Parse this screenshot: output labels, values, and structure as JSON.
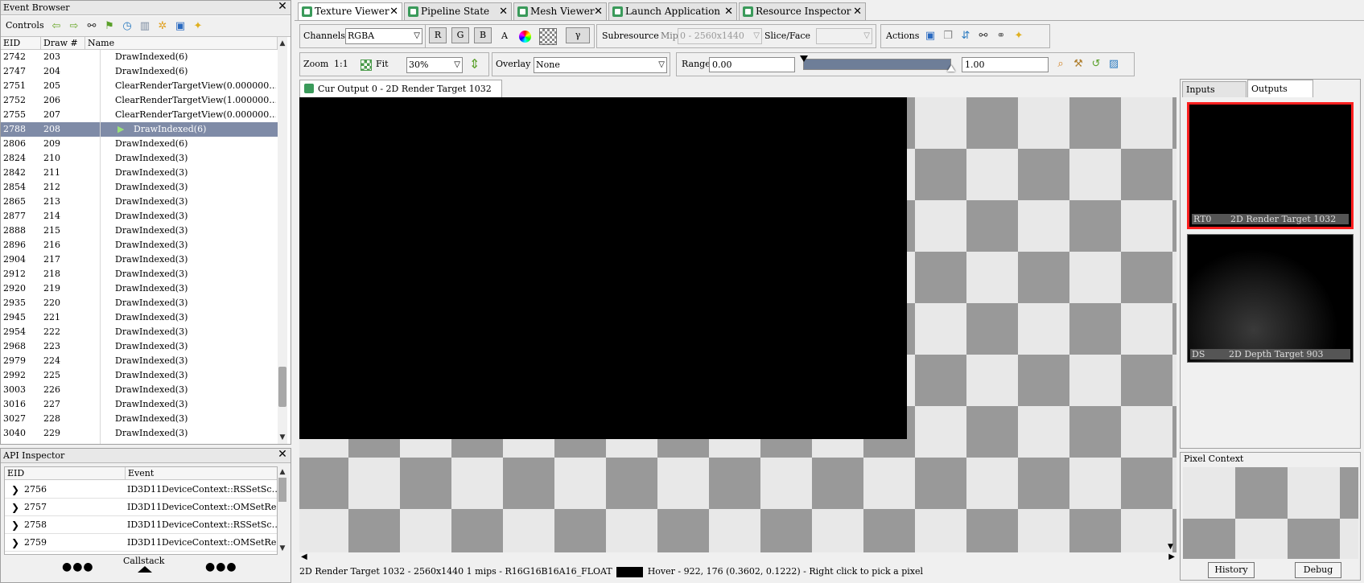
{
  "event_browser": {
    "title": "Event Browser",
    "controls_label": "Controls",
    "columns": [
      "EID",
      "Draw #",
      "Name"
    ],
    "selected_index": 5,
    "rows": [
      {
        "eid": "2742",
        "draw": "203",
        "name": "DrawIndexed(6)"
      },
      {
        "eid": "2747",
        "draw": "204",
        "name": "DrawIndexed(6)"
      },
      {
        "eid": "2751",
        "draw": "205",
        "name": "ClearRenderTargetView(0.000000…"
      },
      {
        "eid": "2752",
        "draw": "206",
        "name": "ClearRenderTargetView(1.000000…"
      },
      {
        "eid": "2755",
        "draw": "207",
        "name": "ClearRenderTargetView(0.000000…"
      },
      {
        "eid": "2788",
        "draw": "208",
        "name": "DrawIndexed(6)"
      },
      {
        "eid": "2806",
        "draw": "209",
        "name": "DrawIndexed(6)"
      },
      {
        "eid": "2824",
        "draw": "210",
        "name": "DrawIndexed(3)"
      },
      {
        "eid": "2842",
        "draw": "211",
        "name": "DrawIndexed(3)"
      },
      {
        "eid": "2854",
        "draw": "212",
        "name": "DrawIndexed(3)"
      },
      {
        "eid": "2865",
        "draw": "213",
        "name": "DrawIndexed(3)"
      },
      {
        "eid": "2877",
        "draw": "214",
        "name": "DrawIndexed(3)"
      },
      {
        "eid": "2888",
        "draw": "215",
        "name": "DrawIndexed(3)"
      },
      {
        "eid": "2896",
        "draw": "216",
        "name": "DrawIndexed(3)"
      },
      {
        "eid": "2904",
        "draw": "217",
        "name": "DrawIndexed(3)"
      },
      {
        "eid": "2912",
        "draw": "218",
        "name": "DrawIndexed(3)"
      },
      {
        "eid": "2920",
        "draw": "219",
        "name": "DrawIndexed(3)"
      },
      {
        "eid": "2935",
        "draw": "220",
        "name": "DrawIndexed(3)"
      },
      {
        "eid": "2945",
        "draw": "221",
        "name": "DrawIndexed(3)"
      },
      {
        "eid": "2954",
        "draw": "222",
        "name": "DrawIndexed(3)"
      },
      {
        "eid": "2968",
        "draw": "223",
        "name": "DrawIndexed(3)"
      },
      {
        "eid": "2979",
        "draw": "224",
        "name": "DrawIndexed(3)"
      },
      {
        "eid": "2992",
        "draw": "225",
        "name": "DrawIndexed(3)"
      },
      {
        "eid": "3003",
        "draw": "226",
        "name": "DrawIndexed(3)"
      },
      {
        "eid": "3016",
        "draw": "227",
        "name": "DrawIndexed(3)"
      },
      {
        "eid": "3027",
        "draw": "228",
        "name": "DrawIndexed(3)"
      },
      {
        "eid": "3040",
        "draw": "229",
        "name": "DrawIndexed(3)"
      }
    ]
  },
  "api_inspector": {
    "title": "API Inspector",
    "columns": [
      "EID",
      "Event"
    ],
    "rows": [
      {
        "eid": "2756",
        "event": "ID3D11DeviceContext::RSSetSc…"
      },
      {
        "eid": "2757",
        "event": "ID3D11DeviceContext::OMSetRe…"
      },
      {
        "eid": "2758",
        "event": "ID3D11DeviceContext::RSSetSc…"
      },
      {
        "eid": "2759",
        "event": "ID3D11DeviceContext::OMSetRe…"
      }
    ],
    "callstack_label": "Callstack"
  },
  "tabs": [
    {
      "label": "Texture Viewer",
      "active": true
    },
    {
      "label": "Pipeline State",
      "active": false
    },
    {
      "label": "Mesh Viewer",
      "active": false
    },
    {
      "label": "Launch Application",
      "active": false
    },
    {
      "label": "Resource Inspector",
      "active": false
    }
  ],
  "toolbar": {
    "channels_label": "Channels",
    "channels_value": "RGBA",
    "r": "R",
    "g": "G",
    "b": "B",
    "a": "A",
    "gamma_label": "γ",
    "subresource_label": "Subresource",
    "mip_label": "Mip",
    "mip_value": "0 - 2560x1440",
    "slice_label": "Slice/Face",
    "actions_label": "Actions",
    "zoom_label": "Zoom",
    "zoom_11": "1:1",
    "fit_label": "Fit",
    "zoom_value": "30%",
    "overlay_label": "Overlay",
    "overlay_value": "None",
    "range_label": "Range",
    "range_min": "0.00",
    "range_max": "1.00"
  },
  "viewer": {
    "tab_label": "Cur Output 0 - 2D Render Target 1032",
    "status_prefix": "2D Render Target 1032 -  2560x1440 1 mips -  R16G16B16A16_FLOAT",
    "status_hover": "Hover -    922,  176 (0.3602, 0.1222)  - Right click to pick a pixel"
  },
  "side_panel": {
    "tab_inputs": "Inputs",
    "tab_outputs": "Outputs",
    "thumb1_slot": "RT0",
    "thumb1_name": "2D Render Target 1032",
    "thumb2_slot": "DS",
    "thumb2_name": "2D Depth Target 903",
    "accent": "#ff2020"
  },
  "pixel_context": {
    "title": "Pixel Context",
    "history": "History",
    "debug": "Debug"
  }
}
